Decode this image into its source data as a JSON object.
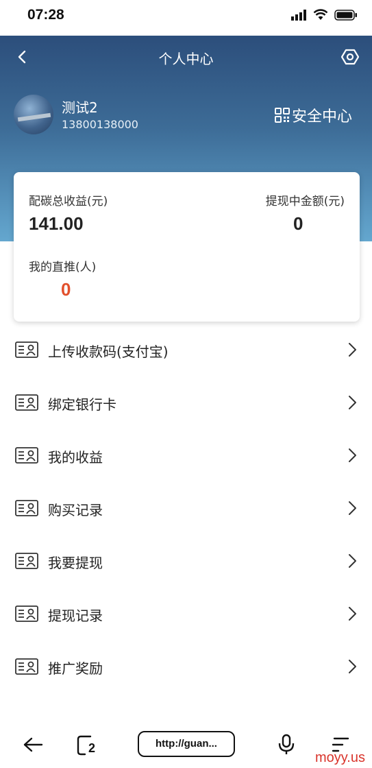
{
  "status_bar": {
    "time": "07:28"
  },
  "header": {
    "title": "个人中心"
  },
  "user": {
    "name": "测试2",
    "phone": "13800138000",
    "security_label": "安全中心"
  },
  "stats": {
    "total_income_label": "配碳总收益(元)",
    "total_income_value": "141.00",
    "withdrawing_label": "提现中金额(元)",
    "withdrawing_value": "0",
    "direct_referrals_label": "我的直推(人)",
    "direct_referrals_value": "0"
  },
  "menu": [
    {
      "label": "上传收款码(支付宝)"
    },
    {
      "label": "绑定银行卡"
    },
    {
      "label": "我的收益"
    },
    {
      "label": "购买记录"
    },
    {
      "label": "我要提现"
    },
    {
      "label": "提现记录"
    },
    {
      "label": "推广奖励"
    }
  ],
  "browser": {
    "url": "http://guan...",
    "tabs_count": "2"
  },
  "watermark": "moyy.us",
  "colors": {
    "accent_red": "#e2502c",
    "header_top": "#2c4e7b",
    "header_bottom": "#64a7cf"
  }
}
